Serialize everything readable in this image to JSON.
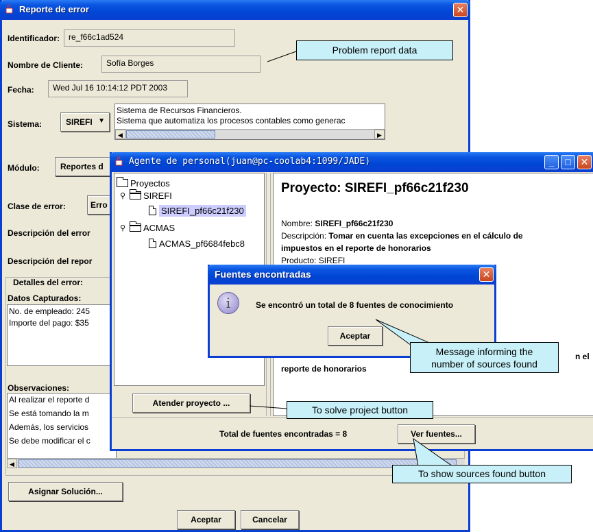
{
  "main_window": {
    "title": "Reporte de error",
    "identificador_label": "Identificador:",
    "identificador_value": "re_f66c1ad524",
    "cliente_label": "Nombre de Cliente:",
    "cliente_value": "Sofía Borges",
    "fecha_label": "Fecha:",
    "fecha_value": "Wed Jul 16 10:14:12 PDT 2003",
    "sistema_label": "Sistema:",
    "sistema_value": "SIREFI",
    "sistema_desc_line1": "Sistema de Recursos Financieros.",
    "sistema_desc_line2": "Sistema que automatiza los procesos contables como generac",
    "modulo_label": "Módulo:",
    "modulo_value": "Reportes d",
    "clase_label": "Clase de error:",
    "clase_value": "Erro",
    "descripcion_error_label": "Descripción del error",
    "descripcion_reporte_label": "Descripción del repor",
    "detalles_label": "Detalles del error:",
    "datos_label": "Datos Capturados:",
    "datos_lines": [
      "No. de empleado: 245",
      "Importe del pago: $35"
    ],
    "observaciones_label": "Observaciones:",
    "observaciones_lines": [
      "Al realizar el reporte d",
      "Se está tomando la m",
      "Además, los servicios",
      "Se debe modificar el c"
    ],
    "asignar_button": "Asignar Solución...",
    "aceptar_button": "Aceptar",
    "cancelar_button": "Cancelar"
  },
  "agent_window": {
    "title": "Agente de personal(juan@pc-coolab4:1099/JADE)",
    "tree": {
      "root": "Proyectos",
      "group1": "SIREFI",
      "item1": "SIREFI_pf66c21f230",
      "group2": "ACMAS",
      "item2": "ACMAS_pf6684febc8"
    },
    "project_heading": "Proyecto: SIREFI_pf66c21f230",
    "nombre_label": "Nombre:",
    "nombre_value": "SIREFI_pf66c21f230",
    "descripcion_label": "Descripción:",
    "descripcion_line1": "Tomar en cuenta las excepciones en el cálculo de",
    "descripcion_line2": "impuestos en el reporte de honorarios",
    "hidden_partial": "Producto: SIREFI",
    "partial_right": "n el",
    "reporte_line": "reporte de honorarios",
    "atender_button": "Atender proyecto ...",
    "total_text": "Total de fuentes encontradas = 8",
    "ver_fuentes_button": "Ver fuentes..."
  },
  "dialog": {
    "title": "Fuentes encontradas",
    "message": "Se encontró un total de 8 fuentes de conocimiento",
    "aceptar_button": "Aceptar",
    "info_icon_glyph": "i"
  },
  "callouts": {
    "problem_report": "Problem report data",
    "message_line1": "Message informing the",
    "message_line2": "number of sources found",
    "solve_project": "To solve project button",
    "show_sources": "To show sources found button"
  },
  "colors": {
    "xp_title_blue": "#0046d5",
    "window_bg": "#ece9d8",
    "callout_bg": "#c8f0f8",
    "selection": "#ccccff",
    "info_icon": "#a8a0d8"
  }
}
